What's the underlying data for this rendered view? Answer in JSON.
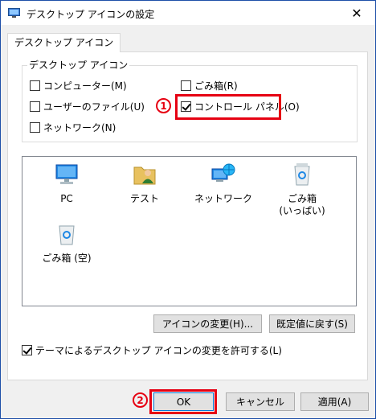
{
  "window": {
    "title": "デスクトップ アイコンの設定",
    "close_glyph": "✕"
  },
  "tab": {
    "label": "デスクトップ アイコン"
  },
  "group": {
    "legend": "デスクトップ アイコン",
    "checkboxes": [
      {
        "label": "コンピューター(M)",
        "checked": false
      },
      {
        "label": "ごみ箱(R)",
        "checked": false
      },
      {
        "label": "ユーザーのファイル(U)",
        "checked": false
      },
      {
        "label": "コントロール パネル(O)",
        "checked": true
      },
      {
        "label": "ネットワーク(N)",
        "checked": false
      }
    ]
  },
  "icons": [
    {
      "label": "PC",
      "icon": "pc-icon"
    },
    {
      "label": "テスト",
      "icon": "user-folder-icon"
    },
    {
      "label": "ネットワーク",
      "icon": "network-icon"
    },
    {
      "label": "ごみ箱\n(いっぱい)",
      "icon": "recycle-bin-full-icon"
    },
    {
      "label": "ごみ箱 (空)",
      "icon": "recycle-bin-empty-icon"
    }
  ],
  "buttons": {
    "change_icon": "アイコンの変更(H)...",
    "restore_default": "既定値に戻す(S)",
    "ok": "OK",
    "cancel": "キャンセル",
    "apply": "適用(A)"
  },
  "theme_checkbox": {
    "label": "テーマによるデスクトップ アイコンの変更を許可する(L)",
    "checked": true
  },
  "annotations": {
    "step1": "1",
    "step2": "2"
  },
  "colors": {
    "highlight": "#e60012",
    "titlebar_border": "#1e4fa8",
    "accent": "#0078d7"
  }
}
